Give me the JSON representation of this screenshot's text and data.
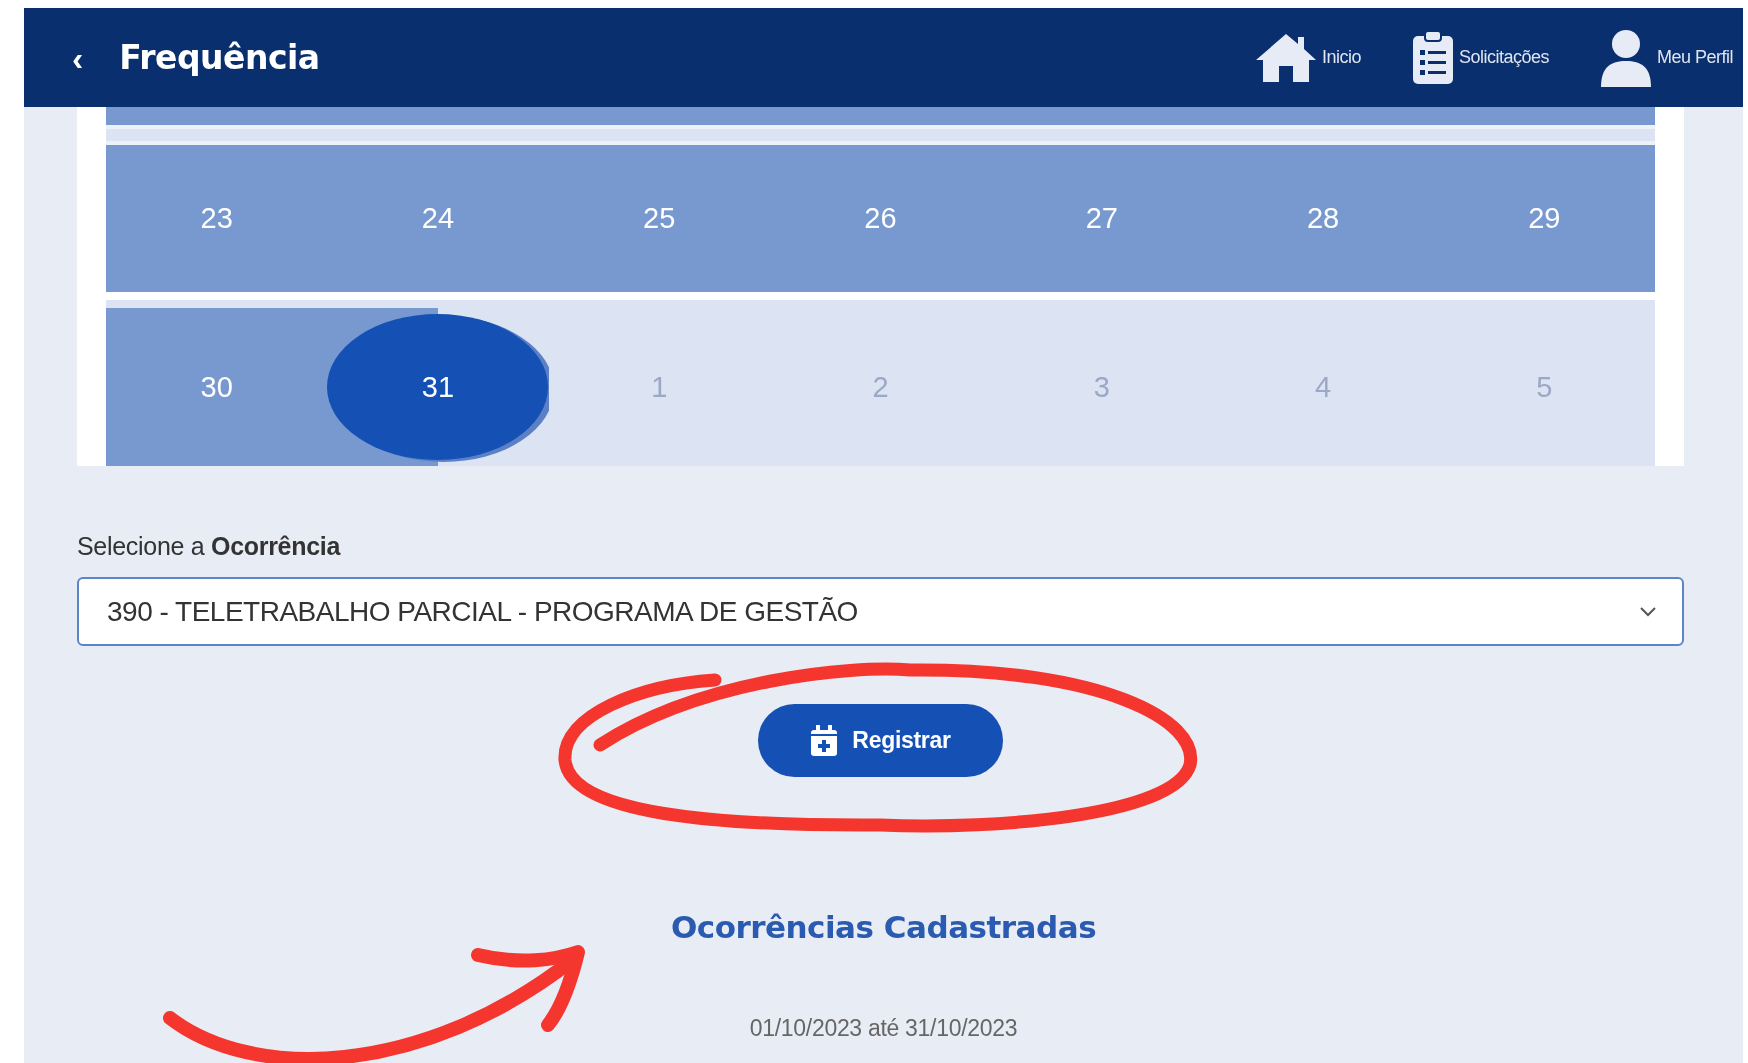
{
  "header": {
    "title": "Frequência",
    "back": "‹",
    "nav": [
      {
        "label": "Inicio"
      },
      {
        "label": "Solicitações"
      },
      {
        "label": "Meu Perfil"
      }
    ]
  },
  "calendar": {
    "weeks": [
      {
        "days": [
          {
            "label": "23",
            "outside": false,
            "selected": false
          },
          {
            "label": "24",
            "outside": false,
            "selected": false
          },
          {
            "label": "25",
            "outside": false,
            "selected": false
          },
          {
            "label": "26",
            "outside": false,
            "selected": false
          },
          {
            "label": "27",
            "outside": false,
            "selected": false
          },
          {
            "label": "28",
            "outside": false,
            "selected": false
          },
          {
            "label": "29",
            "outside": false,
            "selected": false
          }
        ]
      },
      {
        "days": [
          {
            "label": "30",
            "outside": false,
            "selected": false
          },
          {
            "label": "31",
            "outside": false,
            "selected": true
          },
          {
            "label": "1",
            "outside": true,
            "selected": false
          },
          {
            "label": "2",
            "outside": true,
            "selected": false
          },
          {
            "label": "3",
            "outside": true,
            "selected": false
          },
          {
            "label": "4",
            "outside": true,
            "selected": false
          },
          {
            "label": "5",
            "outside": true,
            "selected": false
          }
        ]
      }
    ]
  },
  "occurrence": {
    "label": "Selecione a **Ocorrência**",
    "value": "390 - TELETRABALHO PARCIAL - PROGRAMA DE GESTÃO",
    "button": "Registrar"
  },
  "registered": {
    "title": "Ocorrências Cadastradas",
    "period": "01/10/2023 até 31/10/2023"
  }
}
